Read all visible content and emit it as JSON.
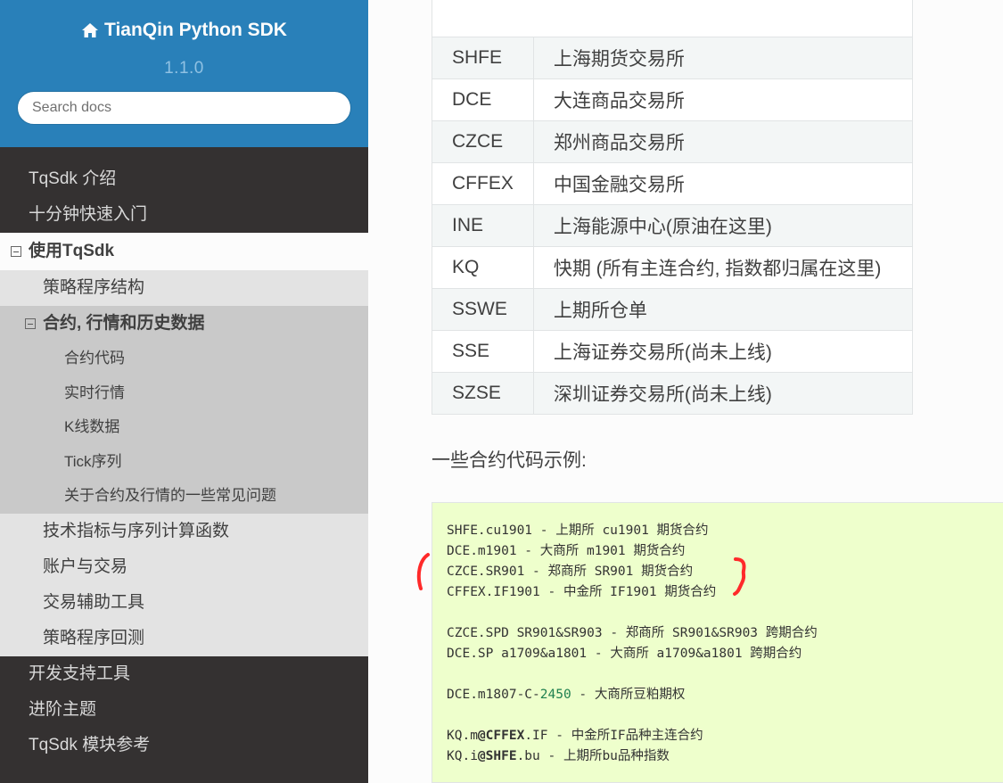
{
  "sidebar": {
    "brand": "TianQin Python SDK",
    "version": "1.1.0",
    "search_placeholder": "Search docs",
    "top_items": [
      "TqSdk 介绍",
      "十分钟快速入门"
    ],
    "current_item": "使用TqSdk",
    "sub_items_before": [
      "策略程序结构"
    ],
    "current_sub_item": "合约, 行情和历史数据",
    "sub_sub_items": [
      "合约代码",
      "实时行情",
      "K线数据",
      "Tick序列",
      "关于合约及行情的一些常见问题"
    ],
    "sub_items_after": [
      "技术指标与序列计算函数",
      "账户与交易",
      "交易辅助工具",
      "策略程序回测"
    ],
    "bottom_items": [
      "开发支持工具",
      "进阶主题",
      "TqSdk 模块参考"
    ]
  },
  "exchange_table": {
    "rows": [
      {
        "code": "SHFE",
        "name": "上海期货交易所"
      },
      {
        "code": "DCE",
        "name": "大连商品交易所"
      },
      {
        "code": "CZCE",
        "name": "郑州商品交易所"
      },
      {
        "code": "CFFEX",
        "name": "中国金融交易所"
      },
      {
        "code": "INE",
        "name": "上海能源中心(原油在这里)"
      },
      {
        "code": "KQ",
        "name": "快期 (所有主连合约, 指数都归属在这里)"
      },
      {
        "code": "SSWE",
        "name": "上期所仓单"
      },
      {
        "code": "SSE",
        "name": "上海证券交易所(尚未上线)"
      },
      {
        "code": "SZSE",
        "name": "深圳证券交易所(尚未上线)"
      }
    ]
  },
  "examples_title": "一些合约代码示例:",
  "code_example": {
    "group1": [
      "SHFE.cu1901 - 上期所 cu1901 期货合约",
      "DCE.m1901 - 大商所 m1901 期货合约",
      "CZCE.SR901 - 郑商所 SR901 期货合约",
      "CFFEX.IF1901 - 中金所 IF1901 期货合约"
    ],
    "group2": [
      "CZCE.SPD SR901&SR903 - 郑商所 SR901&SR903 跨期合约",
      "DCE.SP a1709&a1801 - 大商所 a1709&a1801 跨期合约"
    ],
    "option_line": {
      "prefix": "DCE.m1807-C-",
      "number": "2450",
      "suffix": " - 大商所豆粕期权"
    },
    "kq_lines": [
      {
        "prefix": "KQ.m",
        "at": "@CFFEX",
        "suffix": ".IF - 中金所IF品种主连合约"
      },
      {
        "prefix": "KQ.i",
        "at": "@SHFE",
        "suffix": ".bu - 上期所bu品种指数"
      }
    ]
  },
  "colors": {
    "sidebar_header": "#2980b9",
    "sidebar_bg": "#343131",
    "code_bg": "#eeffcc",
    "annotation": "#ff2a2a"
  }
}
